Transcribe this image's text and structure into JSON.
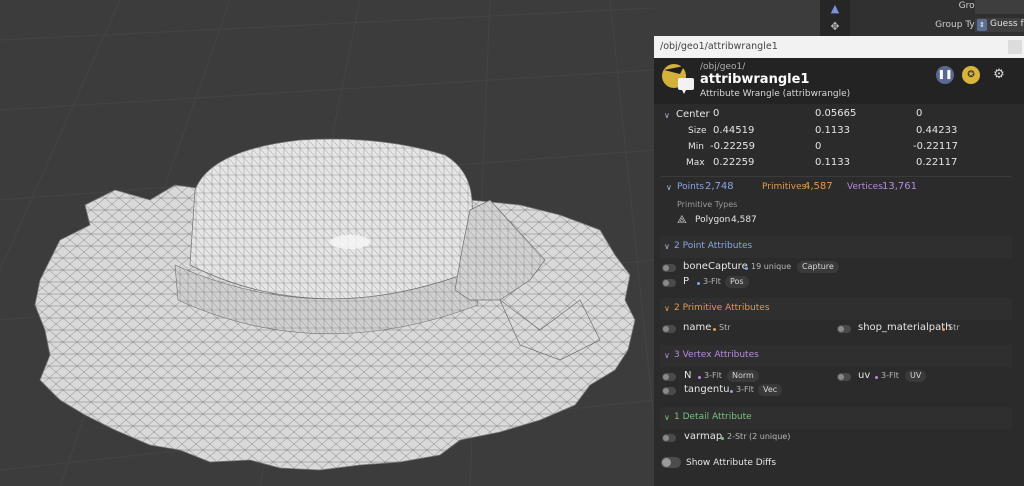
{
  "param_strip": {
    "group_label": "Group",
    "group_type_label": "Group Type",
    "group_type_value": "Guess fr"
  },
  "popup": {
    "title": "/obj/geo1/attribwrangle1",
    "header": {
      "path": "/obj/geo1/",
      "node_name": "attribwrangle1",
      "node_type": "Attribute Wrangle  (attribwrangle)"
    },
    "bounds": {
      "rows": [
        {
          "label": "Center",
          "x": "0",
          "y": "0.05665",
          "z": "0"
        },
        {
          "label": "Size",
          "x": "0.44519",
          "y": "0.1133",
          "z": "0.44233"
        },
        {
          "label": "Min",
          "x": "-0.22259",
          "y": "0",
          "z": "-0.22117"
        },
        {
          "label": "Max",
          "x": "0.22259",
          "y": "0.1133",
          "z": "0.22117"
        }
      ]
    },
    "counts": {
      "points_label": "Points",
      "points_value": "2,748",
      "primitives_label": "Primitives",
      "primitives_value": "4,587",
      "vertices_label": "Vertices",
      "vertices_value": "13,761",
      "primitive_types_label": "Primitive Types",
      "polygon_label": "Polygon",
      "polygon_value": "4,587"
    },
    "sections": {
      "point": {
        "title": "2 Point Attributes",
        "attrs": [
          {
            "name": "boneCapture",
            "meta": "19 unique",
            "pill": "Capture"
          },
          {
            "name": "P",
            "meta": "3-Flt",
            "pill": "Pos"
          }
        ]
      },
      "primitive": {
        "title": "2 Primitive Attributes",
        "attrs": [
          {
            "name": "name",
            "meta": "Str"
          },
          {
            "name": "shop_materialpath",
            "meta": "Str"
          }
        ]
      },
      "vertex": {
        "title": "3 Vertex Attributes",
        "attrs": [
          {
            "name": "N",
            "meta": "3-Flt",
            "pill": "Norm"
          },
          {
            "name": "uv",
            "meta": "3-Flt",
            "pill": "UV"
          },
          {
            "name": "tangentu",
            "meta": "3-Flt",
            "pill": "Vec"
          }
        ]
      },
      "detail": {
        "title": "1 Detail Attribute",
        "attrs": [
          {
            "name": "varmap",
            "meta": "2-Str (2 unique)"
          }
        ]
      }
    },
    "show_diffs_label": "Show Attribute Diffs"
  },
  "colors": {
    "points": "#8aa4e8",
    "primitives": "#e6984c",
    "vertices": "#b58be0",
    "point_section": "#8aa4e8",
    "primitive_section": "#e6984c",
    "vertex_section": "#b58be0",
    "detail_section": "#77c281"
  }
}
